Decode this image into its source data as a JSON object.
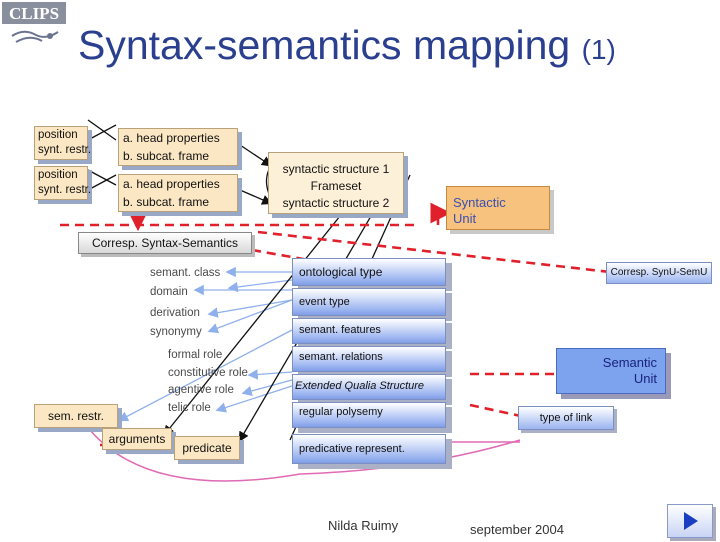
{
  "logo_text": "CLIPS",
  "title": "Syntax-semantics mapping",
  "title_suffix": "(1)",
  "syntax_rows": [
    {
      "pos1": "position",
      "pos2": "synt. restr.",
      "head": "a. head properties",
      "sub": "b. subcat. frame"
    },
    {
      "pos1": "position",
      "pos2": "synt. restr.",
      "head": "a. head properties",
      "sub": "b. subcat. frame"
    }
  ],
  "frameset": {
    "line1": "syntactic structure 1",
    "line2": "Frameset",
    "line3": "syntactic structure 2"
  },
  "syntactic_unit": "Syntactic\nUnit",
  "corresp_syn_sem": "Corresp. Syntax-Semantics",
  "corresp_synu_semu": "Corresp. SynU-SemU",
  "semantic_unit": "Semantic\nUnit",
  "type_of_link": "type of link",
  "left_labels": {
    "group1": [
      "semant. class",
      "domain"
    ],
    "group2": [
      "derivation",
      "synonymy"
    ],
    "group3": [
      "formal role",
      "constitutive role",
      "agentive role",
      "telic role"
    ]
  },
  "sem_restr": "sem. restr.",
  "arguments": "arguments",
  "predicate": "predicate",
  "semantic_boxes": [
    "ontological type",
    "event type",
    "semant. features",
    "semant. relations",
    "Extended Qualia Structure",
    "regular polysemy",
    "predicative represent."
  ],
  "footer": {
    "author": "Nilda Ruimy",
    "date": "september 2004"
  },
  "colors": {
    "title": "#2b3f8f",
    "red_link": "#e0202a",
    "blue_arrow": "#8fb0ea",
    "pink_arrow": "#e06ab4"
  }
}
